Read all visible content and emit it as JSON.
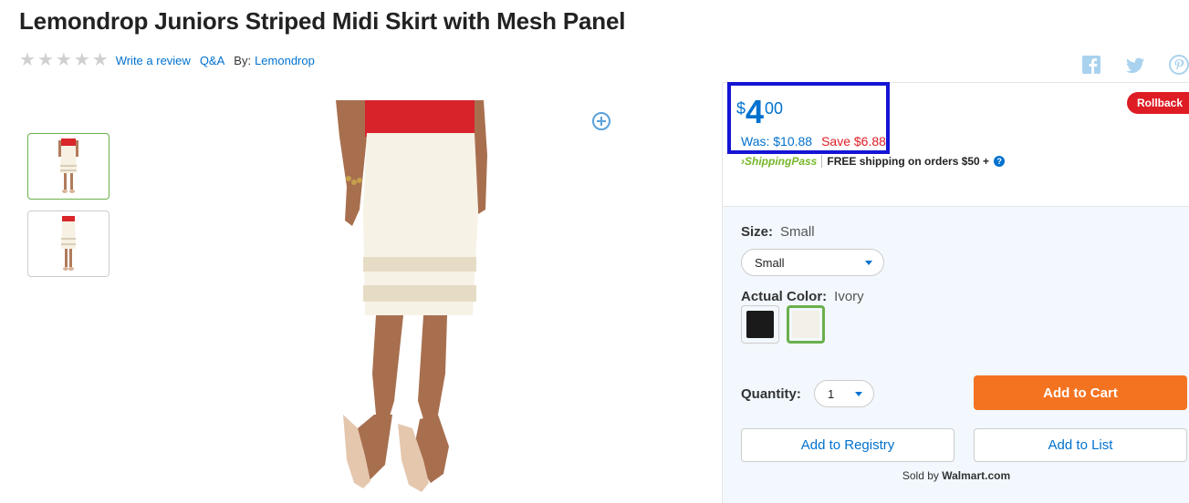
{
  "product": {
    "title": "Lemondrop Juniors Striped Midi Skirt with Mesh Panel",
    "rating_stars": 0,
    "write_review": "Write a review",
    "qa": "Q&A",
    "by_label": "By:",
    "brand": "Lemondrop"
  },
  "social": {
    "icons": [
      "facebook-icon",
      "twitter-icon",
      "pinterest-icon"
    ]
  },
  "price": {
    "currency": "$",
    "dollars": "4",
    "cents": "00",
    "was": "Was: $10.88",
    "save": "Save $6.88",
    "badge": "Rollback"
  },
  "shipping": {
    "logo": "ShippingPass",
    "text": "FREE shipping on orders $50 +",
    "help": "?"
  },
  "options": {
    "size_label": "Size:",
    "size_value": "Small",
    "size_selected": "Small",
    "color_label": "Actual Color:",
    "color_value": "Ivory",
    "swatches": [
      {
        "name": "Black",
        "color": "#1a1a1a"
      },
      {
        "name": "Ivory",
        "color": "#f3f1e7"
      }
    ],
    "quantity_label": "Quantity:",
    "quantity_value": "1"
  },
  "actions": {
    "add_to_cart": "Add to Cart",
    "add_to_registry": "Add to Registry",
    "add_to_list": "Add to List"
  },
  "seller": {
    "sold_by": "Sold by",
    "name": "Walmart.com"
  },
  "colors": {
    "accent": "#0071ce",
    "cart": "#f47321",
    "save": "#de1c24",
    "highlight_box": "#1414d4"
  }
}
